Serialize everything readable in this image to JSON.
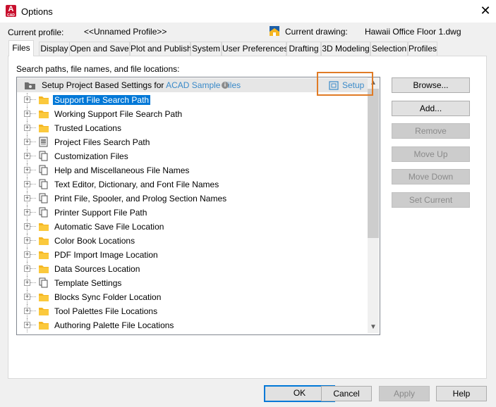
{
  "window": {
    "title": "Options",
    "app_icon_letter": "A",
    "app_icon_sub": "CAD",
    "close_glyph": "✕"
  },
  "header": {
    "current_profile_label": "Current profile:",
    "current_profile_value": "<<Unnamed Profile>>",
    "current_drawing_label": "Current drawing:",
    "current_drawing_value": "Hawaii Office Floor 1.dwg"
  },
  "tabs": [
    {
      "label": "Files",
      "active": true
    },
    {
      "label": "Display"
    },
    {
      "label": "Open and Save"
    },
    {
      "label": "Plot and Publish"
    },
    {
      "label": "System"
    },
    {
      "label": "User Preferences"
    },
    {
      "label": "Drafting"
    },
    {
      "label": "3D Modeling"
    },
    {
      "label": "Selection"
    },
    {
      "label": "Profiles"
    }
  ],
  "files_panel": {
    "section_label": "Search paths, file names, and file locations:",
    "project_row": {
      "prefix": "Setup Project Based Settings for ",
      "link": "ACAD Sample Files",
      "info_glyph": "i",
      "setup_label": "Setup"
    },
    "items": [
      {
        "label": "Support File Search Path",
        "icon": "folder-icon",
        "selected": true
      },
      {
        "label": "Working Support File Search Path",
        "icon": "folder-icon"
      },
      {
        "label": "Trusted Locations",
        "icon": "folder-icon"
      },
      {
        "label": "Project Files Search Path",
        "icon": "project-file-icon"
      },
      {
        "label": "Customization Files",
        "icon": "files-icon"
      },
      {
        "label": "Help and Miscellaneous File Names",
        "icon": "files-icon"
      },
      {
        "label": "Text Editor, Dictionary, and Font File Names",
        "icon": "files-icon"
      },
      {
        "label": "Print File, Spooler, and Prolog Section Names",
        "icon": "files-icon"
      },
      {
        "label": "Printer Support File Path",
        "icon": "files-icon"
      },
      {
        "label": "Automatic Save File Location",
        "icon": "folder-icon"
      },
      {
        "label": "Color Book Locations",
        "icon": "folder-icon"
      },
      {
        "label": "PDF Import Image Location",
        "icon": "folder-icon"
      },
      {
        "label": "Data Sources Location",
        "icon": "folder-icon"
      },
      {
        "label": "Template Settings",
        "icon": "files-icon"
      },
      {
        "label": "Blocks Sync Folder Location",
        "icon": "folder-icon"
      },
      {
        "label": "Tool Palettes File Locations",
        "icon": "folder-icon"
      },
      {
        "label": "Authoring Palette File Locations",
        "icon": "folder-icon"
      }
    ],
    "buttons": [
      {
        "label": "Browse...",
        "enabled": true
      },
      {
        "label": "Add...",
        "enabled": true
      },
      {
        "label": "Remove",
        "enabled": false
      },
      {
        "label": "Move Up",
        "enabled": false
      },
      {
        "label": "Move Down",
        "enabled": false
      },
      {
        "label": "Set Current",
        "enabled": false
      }
    ]
  },
  "footer": {
    "ok": "OK",
    "cancel": "Cancel",
    "apply": "Apply",
    "help": "Help"
  },
  "colors": {
    "accent": "#0078d7",
    "highlight_box": "#e07b25",
    "link": "#3a8ac9",
    "folder": "#f5b622"
  }
}
